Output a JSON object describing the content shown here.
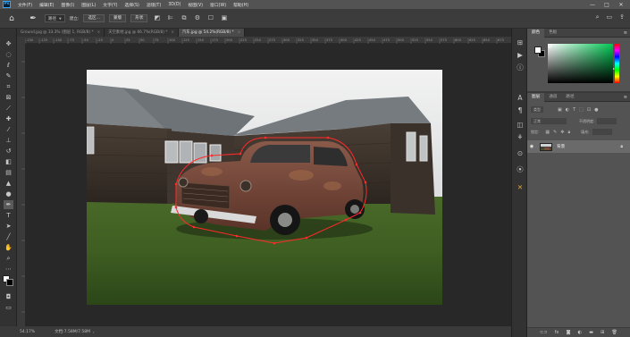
{
  "menu": {
    "logo": "Ps",
    "items": [
      "文件(F)",
      "编辑(E)",
      "图像(I)",
      "图层(L)",
      "文字(Y)",
      "选择(S)",
      "滤镜(T)",
      "3D(D)",
      "视图(V)",
      "窗口(W)",
      "帮助(H)"
    ],
    "window_controls": [
      "—",
      "□",
      "✕"
    ]
  },
  "options": {
    "mode_value": "路径",
    "build_label": "建立:",
    "selection_button": "选区...",
    "mask_button": "蒙版",
    "shape_button": "形状"
  },
  "tabs": [
    {
      "label": "Ground.jpg @ 33.3% (图层 1, RGB/8) *",
      "close": "×"
    },
    {
      "label": "天空素材.jpg @ 66.7%(RGB/8) *",
      "close": "×"
    },
    {
      "label": "汽车.jpg @ 54.2%(RGB/8) *",
      "close": "×"
    }
  ],
  "ruler": {
    "labels": [
      "-150",
      "-125",
      "-100",
      "-75",
      "-50",
      "-25",
      "0",
      "25",
      "50",
      "75",
      "100",
      "125",
      "150",
      "175",
      "200",
      "225",
      "250",
      "275",
      "300",
      "325",
      "350",
      "375",
      "400",
      "425",
      "450",
      "475",
      "500",
      "525",
      "550",
      "575",
      "600",
      "625",
      "650",
      "675"
    ]
  },
  "status": {
    "zoom": "54.17%",
    "doc": "文档:7.58M/7.58M",
    "arrow": "›"
  },
  "color_panel": {
    "tabs": [
      "颜色",
      "色板"
    ],
    "fg": "#ffffff",
    "bg": "#000000",
    "hue_color": "#00c853"
  },
  "layers_panel": {
    "tabs": [
      "图层",
      "通道",
      "路径"
    ],
    "filter_label": "类型",
    "blend_mode": "正常",
    "opacity_label": "不透明度:",
    "lock_label": "锁定:",
    "fill_label": "填充:",
    "layer_name": "背景"
  },
  "colors": {
    "accent_blue": "#31a8ff",
    "path_red": "#ff2a2a"
  }
}
